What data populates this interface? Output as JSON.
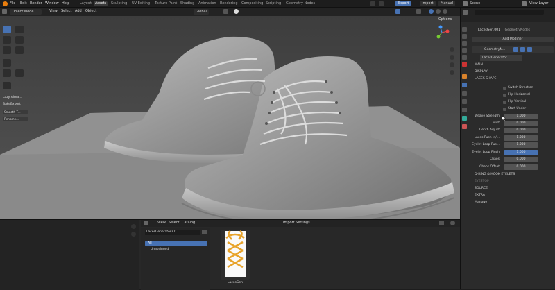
{
  "menubar": {
    "items": [
      "File",
      "Edit",
      "Render",
      "Window",
      "Help"
    ],
    "workspaces": [
      "Layout",
      "Assets",
      "Sculpting",
      "UV Editing",
      "Texture Paint",
      "Shading",
      "Animation",
      "Rendering",
      "Compositing",
      "Scripting",
      "Geometry Nodes"
    ],
    "active_workspace": "Assets",
    "export": "Export",
    "import": "Import",
    "manual": "Manual",
    "scene": "Scene",
    "view_layer": "View Layer"
  },
  "viewport_header": {
    "mode": "Object Mode",
    "menu": [
      "View",
      "Select",
      "Add",
      "Object"
    ],
    "orientation": "Global",
    "options": "Options"
  },
  "sidebar_panel": {
    "section1": "Lazy Alma...",
    "section2": "BakeExport",
    "btn1": "Smooth T...",
    "btn2": "Rename..."
  },
  "properties": {
    "object_name": "LacesGen.001",
    "modifier_tab": "GeometryNodes",
    "add_modifier": "Add Modifier",
    "modifier_name": "GeometryN...",
    "node_group": "LacesGenerator",
    "main": "MAIN",
    "display": "DISPLAY",
    "laces_shape": "LACES SHAPE",
    "switch_direction": "Switch Direction",
    "flip_horizontal": "Flip Horizontal",
    "flip_vertical": "Flip Vertical",
    "start_under": "Start Under",
    "weave_strength": {
      "label": "Weave Strength",
      "value": "1.000"
    },
    "twist": {
      "label": "Twist",
      "value": "0.000"
    },
    "depth_adjust": {
      "label": "Depth Adjust",
      "value": "0.000"
    },
    "laces_push_in": {
      "label": "Laces Push In/...",
      "value": "1.000"
    },
    "eyelet_loop_push": {
      "label": "Eyelet Loop Pus...",
      "value": "1.000"
    },
    "eyelet_loop_pinch": {
      "label": "Eyelet Loop Pinch",
      "value": "1.000"
    },
    "chaos": {
      "label": "Chaos",
      "value": "0.000"
    },
    "chaos_offset": {
      "label": "Chaos Offset",
      "value": "0.000"
    },
    "d_rings": "D-RING & HOOK EYELETS",
    "eyestop": "EYESTOP",
    "source": "SOURCE",
    "extra": "EXTRA",
    "manage": "Manage"
  },
  "asset_browser": {
    "menu": [
      "View",
      "Select",
      "Catalog"
    ],
    "import_settings": "Import Settings",
    "library": "LacesGenerator2.0",
    "catalog_all": "All",
    "catalog_unassigned": "Unassigned",
    "asset_name": "LacesGen"
  },
  "colors": {
    "accent": "#4772b3",
    "lace": "#e8a32a"
  }
}
